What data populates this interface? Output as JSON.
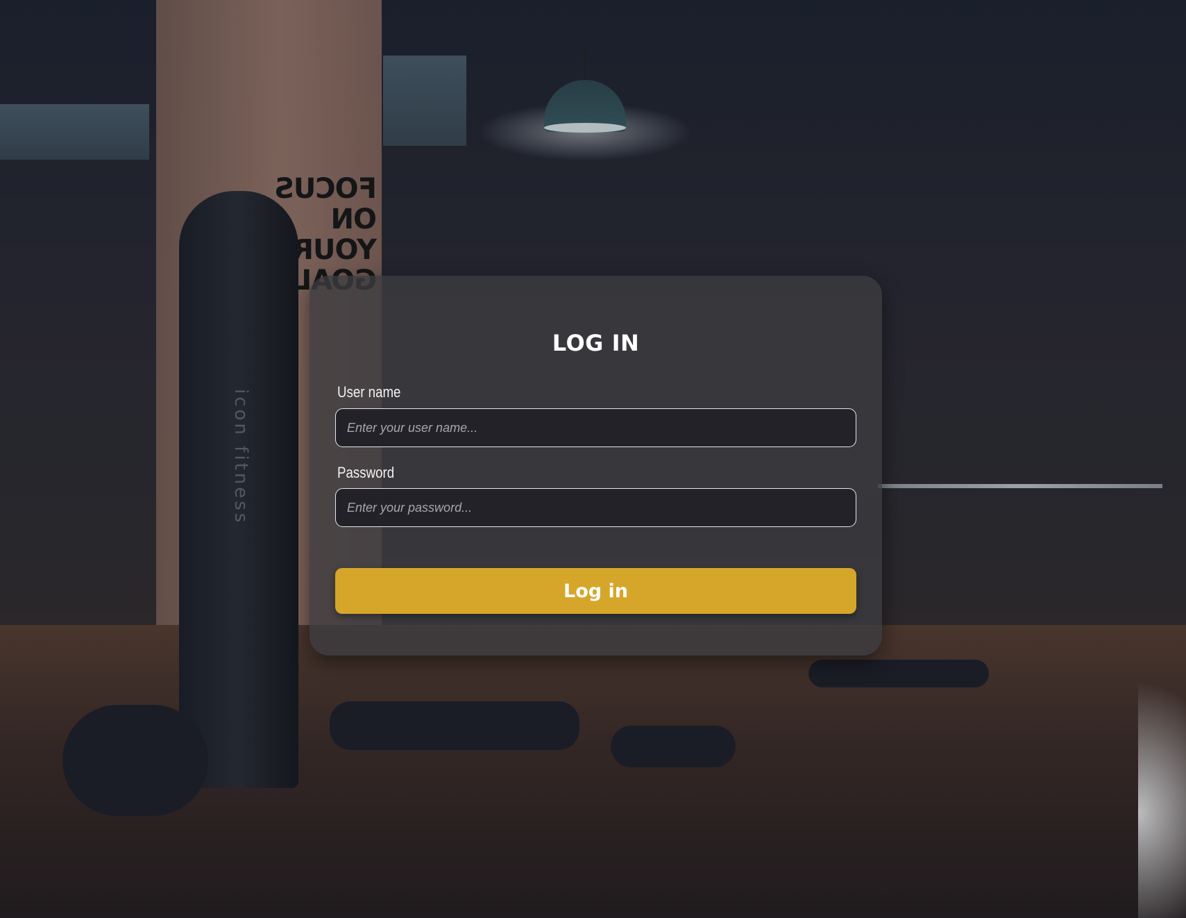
{
  "background": {
    "slogan": "FOCUS ON YOUR GOALS",
    "machine_label": "icon fitness"
  },
  "login": {
    "title": "LOG IN",
    "username": {
      "label": "User name",
      "placeholder": "Enter your user name...",
      "value": ""
    },
    "password": {
      "label": "Password",
      "placeholder": "Enter your password...",
      "value": ""
    },
    "submit_label": "Log in"
  },
  "colors": {
    "accent": "#d6a62a",
    "card_background": "#3c3c40",
    "input_background": "#222228",
    "text": "#ffffff"
  }
}
